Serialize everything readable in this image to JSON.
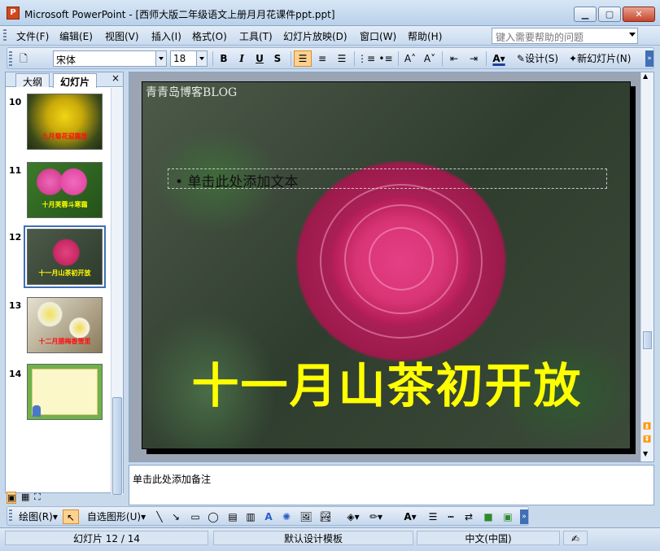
{
  "window": {
    "app_name": "Microsoft PowerPoint",
    "title": "Microsoft PowerPoint - [西师大版二年级语文上册月月花课件ppt.ppt]",
    "icon_letter": "P"
  },
  "menu": {
    "items": [
      "文件(F)",
      "编辑(E)",
      "视图(V)",
      "插入(I)",
      "格式(O)",
      "工具(T)",
      "幻灯片放映(D)",
      "窗口(W)",
      "帮助(H)"
    ],
    "help_placeholder": "键入需要帮助的问题"
  },
  "toolbar": {
    "font_name": "宋体",
    "font_size": "18",
    "bold": "B",
    "italic": "I",
    "underline": "U",
    "shadow": "S",
    "design_label": "设计(S)",
    "new_slide_label": "新幻灯片(N)"
  },
  "panel": {
    "tabs": [
      "大纲",
      "幻灯片"
    ],
    "active_tab": "幻灯片",
    "close": "×",
    "slides": [
      {
        "number": "10",
        "caption": "九月菊花迎霜放"
      },
      {
        "number": "11",
        "caption": "十月芙蓉斗寒霜"
      },
      {
        "number": "12",
        "caption": "十一月山茶初开放"
      },
      {
        "number": "13",
        "caption": "十二月腊梅香雪里"
      },
      {
        "number": "14",
        "caption": ""
      }
    ],
    "selected_slide": "12"
  },
  "slide": {
    "watermark": "青青岛博客BLOG",
    "placeholder_text": "单击此处添加文本",
    "title": "十一月山茶初开放"
  },
  "notes": {
    "placeholder": "单击此处添加备注"
  },
  "drawing": {
    "draw_label": "绘图(R)",
    "autoshape_label": "自选图形(U)"
  },
  "status": {
    "slide_position": "幻灯片 12 / 14",
    "template": "默认设计模板",
    "language": "中文(中国)"
  },
  "colors": {
    "title_yellow": "#ffff00",
    "selection_blue": "#3f6fb5",
    "toolbar_active": "#fcd28e"
  }
}
